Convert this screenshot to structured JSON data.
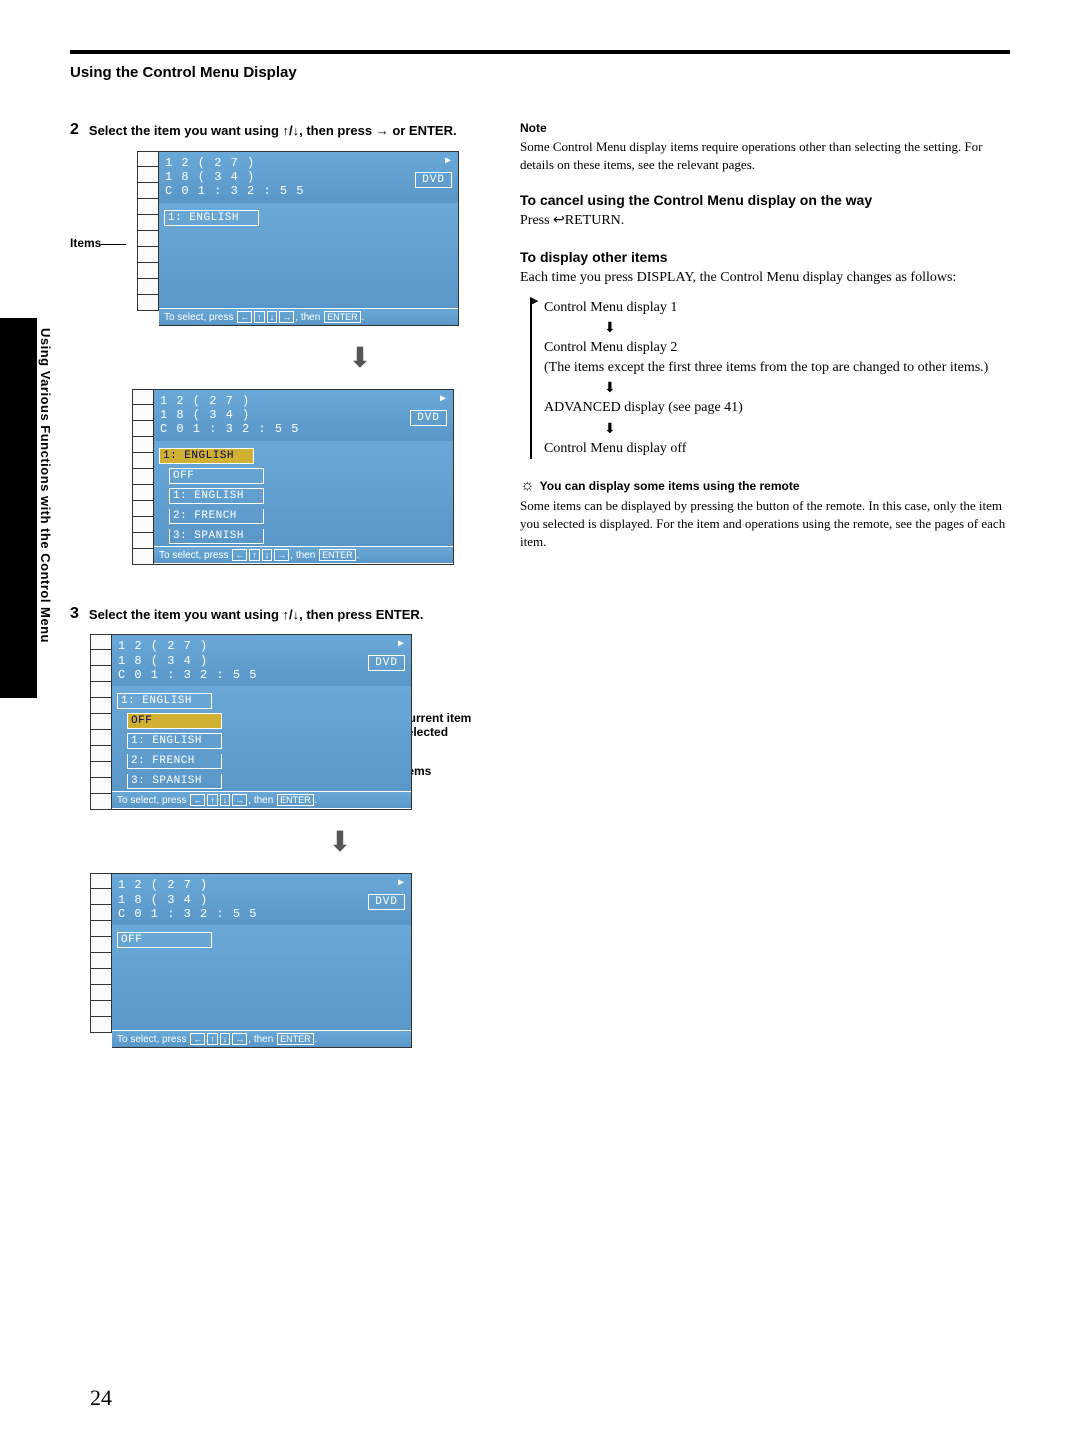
{
  "section_title": "Using the Control Menu Display",
  "steps": {
    "s2": {
      "num": "2",
      "text_a": "Select the item you want using ",
      "text_b": ", then press ",
      "text_c": " or ENTER."
    },
    "s3": {
      "num": "3",
      "text_a": "Select the item you want using ",
      "text_b": ", then press ENTER."
    }
  },
  "labels": {
    "items": "Items",
    "current_item": "Current item selected",
    "items2": "Items"
  },
  "osd": {
    "line1": "1 2 ( 2 7 )",
    "line2": "1 8 ( 3 4 )",
    "line3": "C  0 1 : 3 2 : 5 5",
    "dvd": "DVD",
    "eng1": "1: ENGLISH",
    "off": "OFF",
    "fr": "2: FRENCH",
    "sp": "3: SPANISH",
    "footer_a": "To select, press",
    "footer_b": ", then",
    "footer_enter": "ENTER",
    "footer_dot": "."
  },
  "right": {
    "note_title": "Note",
    "note_body": "Some Control Menu display items require operations other than selecting the setting.  For details on these items, see the relevant pages.",
    "cancel_title": "To cancel using the Control Menu display on the way",
    "cancel_body": "Press ↩RETURN.",
    "display_title": "To display other items",
    "display_body": "Each time you press DISPLAY, the Control Menu display changes as follows:",
    "flow1": "Control Menu display 1",
    "flow2": "Control Menu display 2",
    "flow2b": " (The items except the first three items from the top are changed to other items.)",
    "flow3": "ADVANCED display (see page 41)",
    "flow4": "Control Menu display off",
    "tip_title": "You can display some items using the remote",
    "tip_body": "Some items can be displayed by pressing the button of the remote.  In this case, only the item you selected is displayed.  For the item and operations using the remote,  see the pages of each item."
  },
  "sidebar": "Using Various Functions with the Control Menu",
  "page_num": "24"
}
